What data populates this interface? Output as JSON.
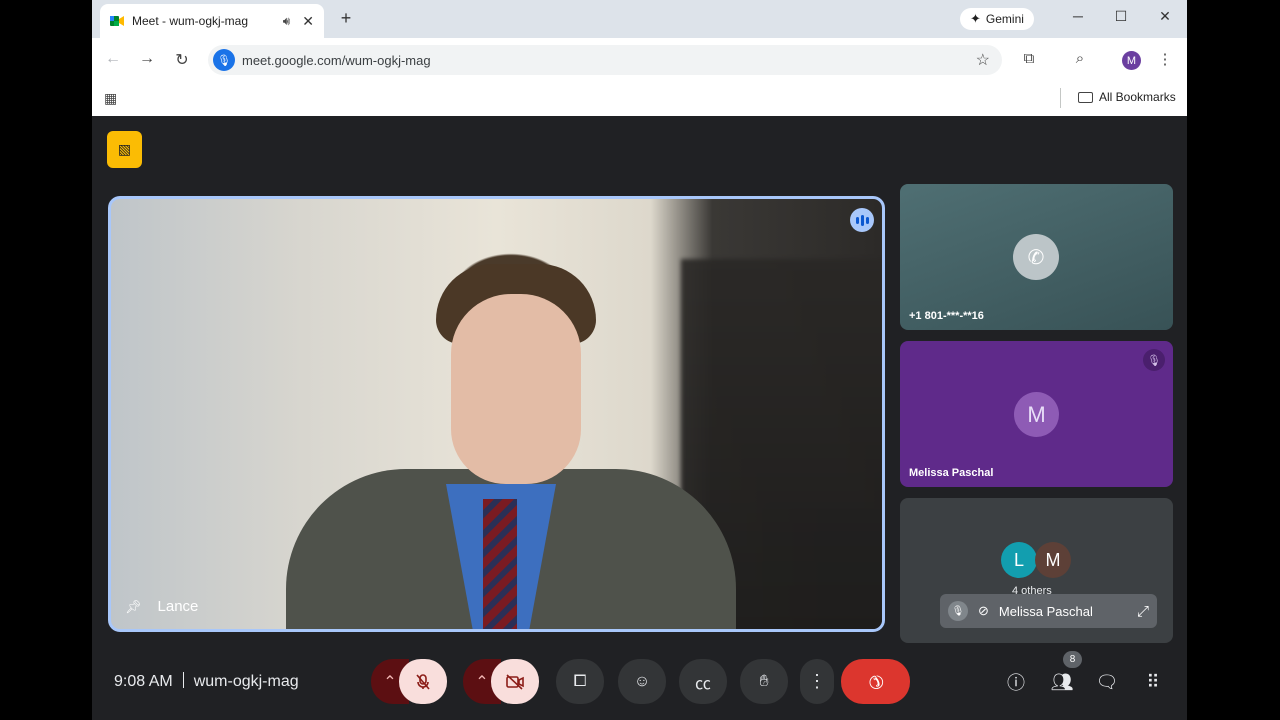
{
  "browser": {
    "tab_title": "Meet - wum-ogkj-mag",
    "url": "meet.google.com/wum-ogkj-mag",
    "gemini_label": "Gemini",
    "profile_initial": "M",
    "bookmarks_label": "All Bookmarks"
  },
  "meeting": {
    "main_speaker": "Lance",
    "time": "9:08 AM",
    "code": "wum-ogkj-mag",
    "participant_count": "8",
    "tiles": [
      {
        "label": "+1 801-***-**16",
        "icon": "phone-icon"
      },
      {
        "label": "Melissa Paschal",
        "initial": "M"
      },
      {
        "initials": [
          "L",
          "M"
        ],
        "others_label": "4 others"
      }
    ],
    "self_view_name": "Melissa Paschal"
  },
  "colors": {
    "accent": "#a8c7fa",
    "end_call": "#dc362e",
    "purple_tile": "#5f2a8a",
    "warning_badge": "#fbbc04"
  }
}
